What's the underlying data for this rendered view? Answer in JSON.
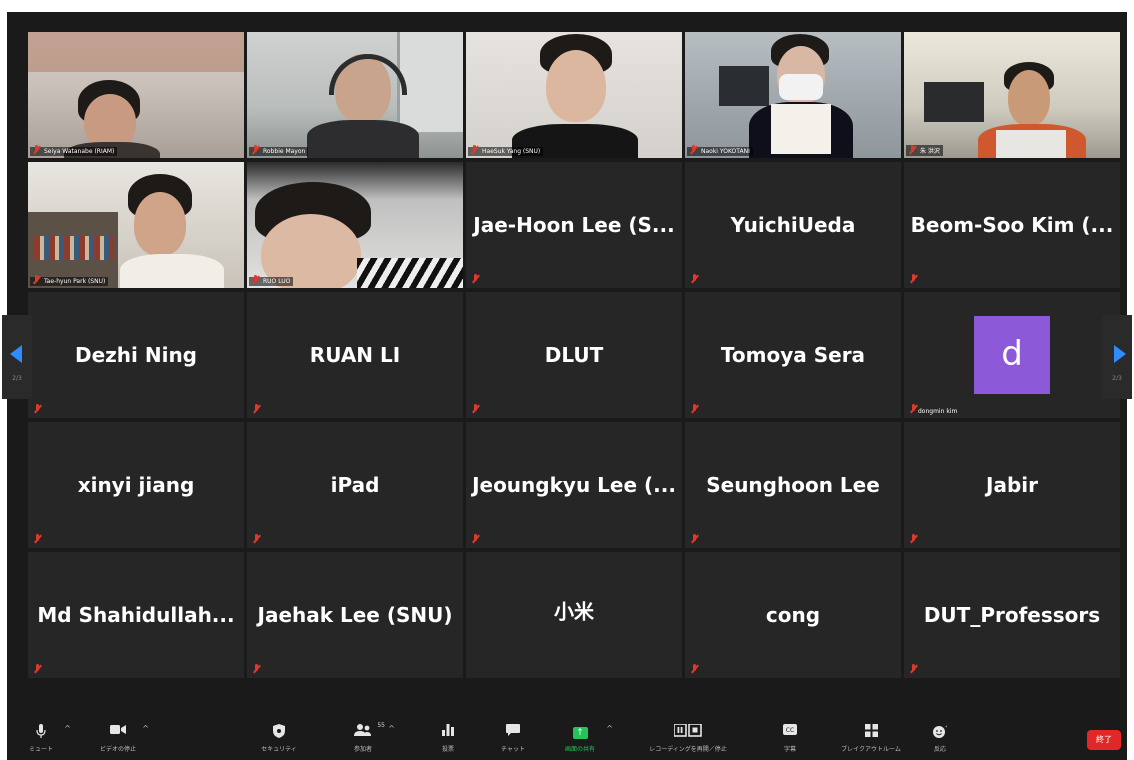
{
  "grid": {
    "row1": [
      {
        "name": "Seiya Watanabe (RIAM)"
      },
      {
        "name": "Robbie Mayon"
      },
      {
        "name": "HaeSuk Yang (SNU)"
      },
      {
        "name": "Naoki YOKOTANI"
      },
      {
        "name": "朱 洪沢"
      }
    ],
    "row2": [
      {
        "name": "Tae-hyun Park (SNU)"
      },
      {
        "name": "RUO LUO"
      },
      {
        "name": "Jae-Hoon Lee (S..."
      },
      {
        "name": "YuichiUeda"
      },
      {
        "name": "Beom-Soo Kim (..."
      }
    ],
    "row3": [
      {
        "name": "Dezhi Ning"
      },
      {
        "name": "RUAN LI"
      },
      {
        "name": "DLUT"
      },
      {
        "name": "Tomoya Sera"
      },
      {
        "name": "dongmin kim",
        "avatar_letter": "d",
        "avatar_color": "#8c59d8"
      }
    ],
    "row4": [
      {
        "name": "xinyi jiang"
      },
      {
        "name": "iPad"
      },
      {
        "name": "Jeoungkyu Lee (..."
      },
      {
        "name": "Seunghoon Lee"
      },
      {
        "name": "Jabir"
      }
    ],
    "row5": [
      {
        "name": "Md  Shahidullah..."
      },
      {
        "name": "Jaehak Lee (SNU)"
      },
      {
        "name": "小米"
      },
      {
        "name": "cong"
      },
      {
        "name": "DUT_Professors"
      }
    ]
  },
  "pager": {
    "left": "2/3",
    "right": "2/3",
    "accent": "#2d8cff"
  },
  "toolbar": {
    "mute": "ミュート",
    "video": "ビデオの停止",
    "security": "セキュリティ",
    "participants": "参加者",
    "participants_count": "55",
    "polls": "投票",
    "chat": "チャット",
    "share": "画面の共有",
    "record": "レコーディングを再開／停止",
    "captions": "字幕",
    "breakout": "ブレイクアウトルーム",
    "reactions": "反応",
    "end": "終了"
  },
  "colors": {
    "end": "#e02828",
    "share": "#23c45a",
    "mute_icon": "#e0382d"
  }
}
